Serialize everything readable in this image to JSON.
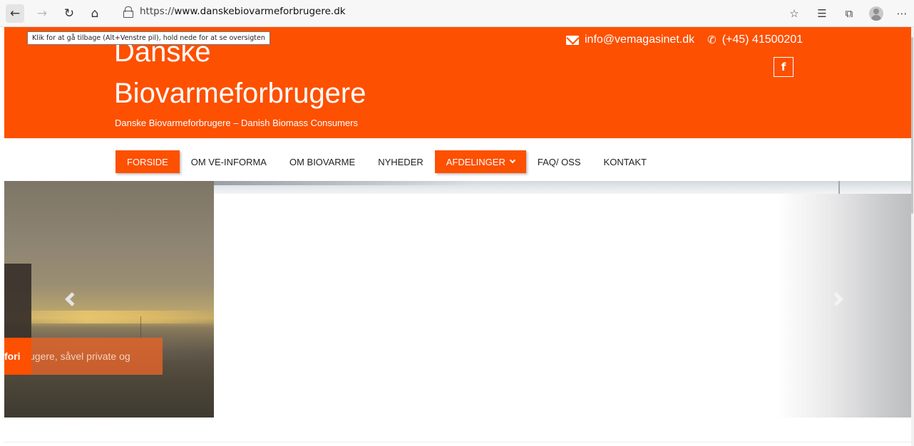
{
  "browser": {
    "url_prefix": "https://",
    "url_host": "www.danskebiovarmeforbrugere.dk",
    "tooltip": "Klik for at gå tilbage (Alt+Venstre pil), hold nede for at se oversigten",
    "icons": [
      "back-arrow-icon",
      "forward-arrow-icon",
      "reload-icon",
      "home-icon",
      "lock-icon",
      "read-aloud-icon",
      "favorites-icon",
      "collections-icon",
      "profile-icon",
      "more-icon"
    ]
  },
  "header": {
    "title_line1": "Danske",
    "title_line2": "Biovarmeforbrugere",
    "tagline": "Danske Biovarmeforbrugere – Danish Biomass Consumers",
    "email": "info@vemagasinet.dk",
    "phone": "(+45) 41500201",
    "facebook_glyph": "f"
  },
  "nav": {
    "items": [
      {
        "label": "FORSIDE",
        "active": true
      },
      {
        "label": "OM VE-INFORMA",
        "active": false
      },
      {
        "label": "OM BIOVARME",
        "active": false
      },
      {
        "label": "NYHEDER",
        "active": false
      },
      {
        "label": "AFDELINGER",
        "active": true,
        "has_dropdown": true
      },
      {
        "label": "FAQ/ OSS",
        "active": false
      },
      {
        "label": "KONTAKT",
        "active": false
      }
    ]
  },
  "slider": {
    "caption_bold": "fori",
    "caption_rest": "brugere, såvel private og"
  },
  "colors": {
    "brand_orange": "#fd5000"
  }
}
